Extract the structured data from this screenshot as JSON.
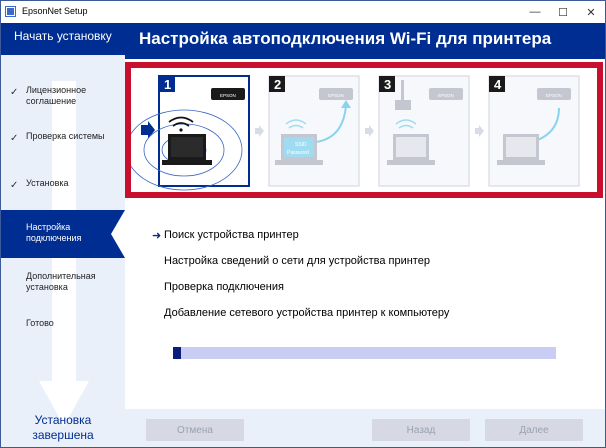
{
  "window": {
    "title": "EpsonNet Setup",
    "minimize_glyph": "—",
    "maximize_glyph": "☐",
    "close_glyph": "✕"
  },
  "sidebar": {
    "title": "Начать установку",
    "steps": [
      {
        "label": "Лицензионное\nсоглашение",
        "done": true
      },
      {
        "label": "Проверка системы",
        "done": true
      },
      {
        "label": "Установка",
        "done": true
      },
      {
        "label": "Настройка\nподключения",
        "active": true
      },
      {
        "label": "Дополнительная\nустановка"
      },
      {
        "label": "Готово"
      }
    ],
    "check_glyph": "✓",
    "footer": "Установка\nзавершена"
  },
  "header": {
    "title": "Настройка автоподключения Wi-Fi для принтера"
  },
  "illustration": {
    "panel_numbers": [
      "1",
      "2",
      "3",
      "4"
    ],
    "printer_brand": "EPSON",
    "ssid_text": "SSID",
    "password_text": "Password"
  },
  "tasks": {
    "current_marker": "➜",
    "items": [
      "Поиск устройства принтер",
      "Настройка сведений о сети для устройства принтер",
      "Проверка подключения",
      "Добавление сетевого устройства принтер к компьютеру"
    ]
  },
  "progress": {
    "percent": 2
  },
  "buttons": {
    "cancel": "Отмена",
    "back": "Назад",
    "next": "Далее"
  },
  "colors": {
    "brand_blue": "#002d91",
    "accent_red": "#c8102e"
  }
}
